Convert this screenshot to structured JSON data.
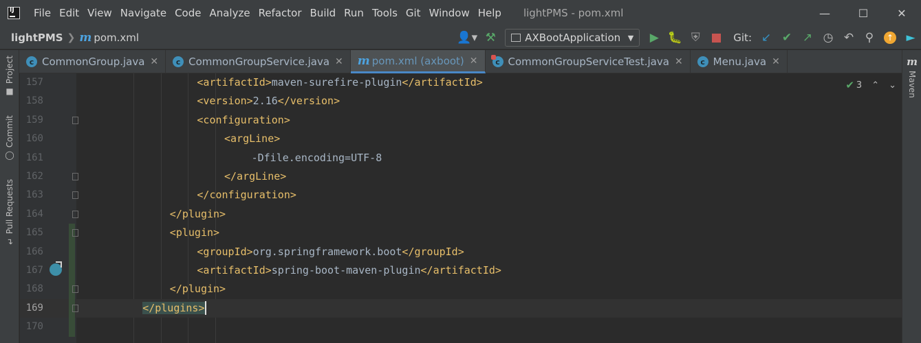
{
  "window": {
    "title": "lightPMS - pom.xml",
    "menu": [
      "File",
      "Edit",
      "View",
      "Navigate",
      "Code",
      "Analyze",
      "Refactor",
      "Build",
      "Run",
      "Tools",
      "Git",
      "Window",
      "Help"
    ]
  },
  "navbar": {
    "project": "lightPMS",
    "file": "pom.xml",
    "run_config": "AXBootApplication",
    "git_label": "Git:"
  },
  "tabs": [
    {
      "label": "CommonGroup.java",
      "icon": "class-icon"
    },
    {
      "label": "CommonGroupService.java",
      "icon": "class-icon"
    },
    {
      "label": "pom.xml (axboot)",
      "icon": "maven-icon",
      "active": true
    },
    {
      "label": "CommonGroupServiceTest.java",
      "icon": "test-class-icon"
    },
    {
      "label": "Menu.java",
      "icon": "class-icon"
    }
  ],
  "sidebars": {
    "left": [
      "Project",
      "Commit",
      "Pull Requests"
    ],
    "right": [
      "Maven"
    ]
  },
  "editor": {
    "inspection_count": "3",
    "lines": [
      {
        "n": "157",
        "indent": 20,
        "parts": [
          [
            "tag",
            "<artifactId>"
          ],
          [
            "txt",
            "maven-surefire-plugin"
          ],
          [
            "tag",
            "</artifactId>"
          ]
        ]
      },
      {
        "n": "158",
        "indent": 20,
        "parts": [
          [
            "tag",
            "<version>"
          ],
          [
            "txt",
            "2.16"
          ],
          [
            "tag",
            "</version>"
          ]
        ]
      },
      {
        "n": "159",
        "indent": 20,
        "parts": [
          [
            "tag",
            "<configuration>"
          ]
        ]
      },
      {
        "n": "160",
        "indent": 24,
        "parts": [
          [
            "tag",
            "<argLine>"
          ]
        ]
      },
      {
        "n": "161",
        "indent": 28,
        "parts": [
          [
            "txt",
            "-Dfile.encoding=UTF-8"
          ]
        ]
      },
      {
        "n": "162",
        "indent": 24,
        "parts": [
          [
            "tag",
            "</argLine>"
          ]
        ]
      },
      {
        "n": "163",
        "indent": 20,
        "parts": [
          [
            "tag",
            "</configuration>"
          ]
        ]
      },
      {
        "n": "164",
        "indent": 16,
        "parts": [
          [
            "tag",
            "</plugin>"
          ]
        ]
      },
      {
        "n": "165",
        "indent": 16,
        "parts": [
          [
            "tag",
            "<plugin>"
          ]
        ]
      },
      {
        "n": "166",
        "indent": 20,
        "parts": [
          [
            "tag",
            "<groupId>"
          ],
          [
            "txt",
            "org.springframework.boot"
          ],
          [
            "tag",
            "</groupId>"
          ]
        ]
      },
      {
        "n": "167",
        "indent": 20,
        "parts": [
          [
            "tag",
            "<artifactId>"
          ],
          [
            "txt",
            "spring-boot-maven-plugin"
          ],
          [
            "tag",
            "</artifactId>"
          ]
        ]
      },
      {
        "n": "168",
        "indent": 16,
        "parts": [
          [
            "tag",
            "</plugin>"
          ]
        ]
      },
      {
        "n": "169",
        "indent": 12,
        "parts": [
          [
            "tag",
            "</plugins>"
          ]
        ],
        "current": true
      },
      {
        "n": "170",
        "indent": 0,
        "parts": []
      }
    ]
  }
}
